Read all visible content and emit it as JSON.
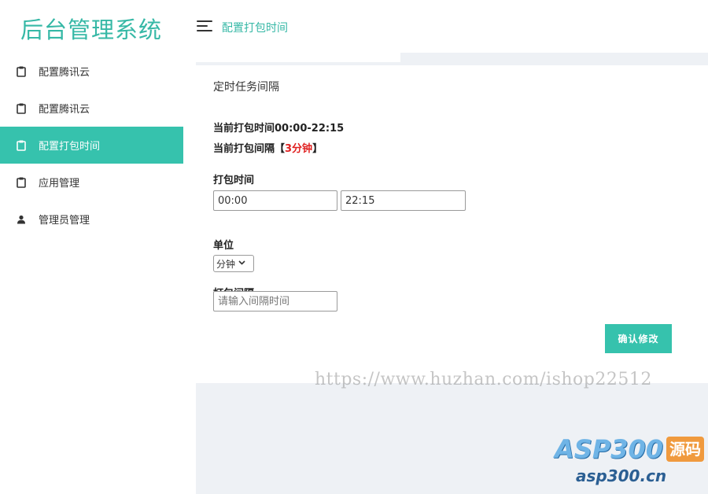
{
  "app": {
    "title": "后台管理系统"
  },
  "header": {
    "breadcrumb": "配置打包时间"
  },
  "sidebar": {
    "items": [
      {
        "label": "配置腾讯云",
        "icon": "clipboard-icon",
        "active": false
      },
      {
        "label": "配置腾讯云",
        "icon": "clipboard-icon",
        "active": false
      },
      {
        "label": "配置打包时间",
        "icon": "clipboard-icon",
        "active": true
      },
      {
        "label": "应用管理",
        "icon": "clipboard-icon",
        "active": false
      },
      {
        "label": "管理员管理",
        "icon": "user-icon",
        "active": false
      }
    ]
  },
  "card": {
    "title": "定时任务间隔",
    "current_time_label": "当前打包时间00:00-22:15",
    "current_interval_prefix": "当前打包间隔【",
    "current_interval_value": "3分钟",
    "current_interval_suffix": "】",
    "pack_time_label": "打包时间",
    "start_time_value": "00:00",
    "end_time_value": "22:15",
    "unit_label": "单位",
    "unit_selected": "分钟",
    "interval_label": "打包间隔",
    "interval_placeholder": "请输入间隔时间",
    "confirm_button": "确认修改"
  },
  "watermark": {
    "url": "https://www.huzhan.com/ishop22512",
    "logo_text": "ASP300",
    "logo_badge": "源码",
    "site": "asp300.cn"
  },
  "colors": {
    "accent": "#36c2ad",
    "highlight": "#e02020"
  }
}
